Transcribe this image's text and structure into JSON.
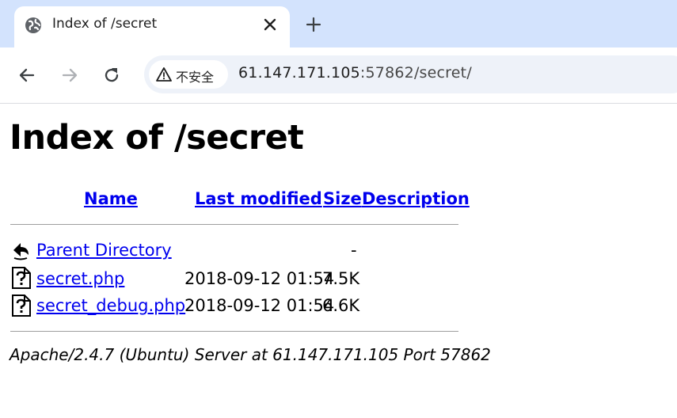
{
  "browser": {
    "tab": {
      "title": "Index of /secret"
    },
    "security_label": "不安全",
    "url_host": "61.147.171.105",
    "url_rest": ":57862/secret/"
  },
  "page": {
    "heading": "Index of /secret",
    "columns": {
      "name": "Name",
      "last_modified": "Last modified",
      "size": "Size",
      "description": "Description"
    },
    "rows": [
      {
        "name": "Parent Directory",
        "modified": "",
        "size": "-",
        "icon": "back-icon"
      },
      {
        "name": "secret.php",
        "modified": "2018-09-12 01:54",
        "size": "7.5K",
        "icon": "unknown-file-icon"
      },
      {
        "name": "secret_debug.php",
        "modified": "2018-09-12 01:54",
        "size": "6.6K",
        "icon": "unknown-file-icon"
      }
    ],
    "footer": "Apache/2.4.7 (Ubuntu) Server at 61.147.171.105 Port 57862"
  },
  "colors": {
    "link": "#0000ee",
    "tabstrip": "#d3e3fd",
    "omnibox": "#eef2f9"
  }
}
